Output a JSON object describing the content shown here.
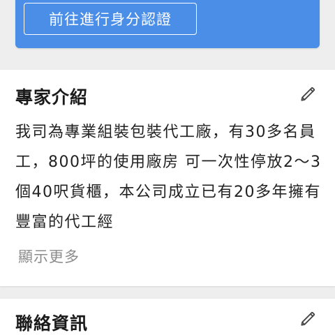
{
  "verify": {
    "button_label": "前往進行身分認證"
  },
  "expert": {
    "title": "專家介紹",
    "edit_icon": "pencil-icon",
    "intro": "我司為專業組裝包裝代工廠，有30多名員工，800坪的使用廠房 可一次性停放2～3個40呎貨櫃，本公司成立已有20多年擁有豐富的代工經",
    "show_more_label": "顯示更多"
  },
  "contact": {
    "title": "聯絡資訊",
    "edit_icon": "pencil-icon"
  },
  "colors": {
    "accent": "#4a8ee8",
    "muted_text": "#8c8c8c",
    "background": "#eeeeee"
  }
}
